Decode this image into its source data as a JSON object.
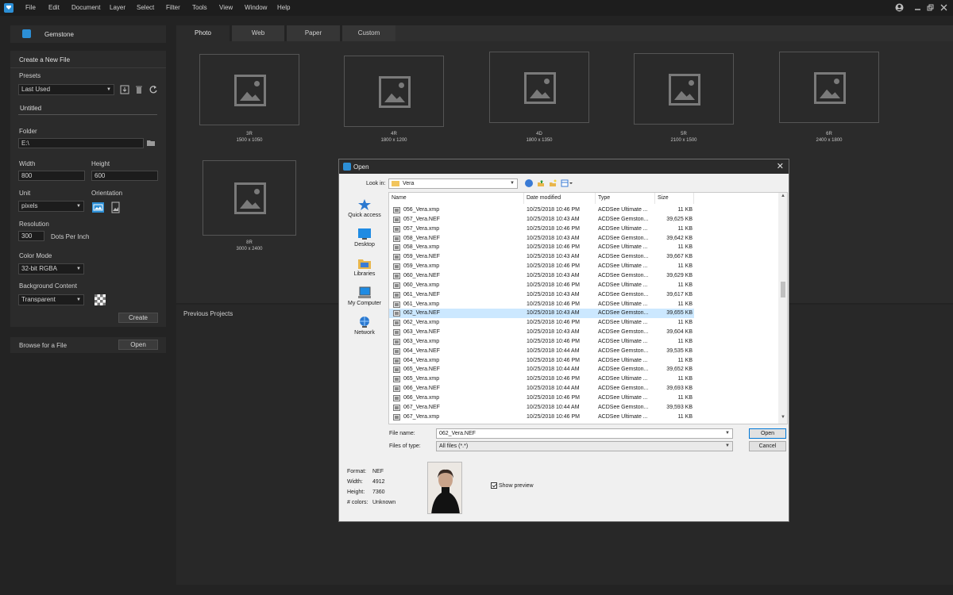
{
  "menu": [
    "File",
    "Edit",
    "Document",
    "Layer",
    "Select",
    "Filter",
    "Tools",
    "View",
    "Window",
    "Help"
  ],
  "app": {
    "name": "Gemstone"
  },
  "create": {
    "heading": "Create a New File",
    "presets_label": "Presets",
    "preset_value": "Last Used",
    "name_value": "Untitled",
    "folder_label": "Folder",
    "folder_value": "E:\\",
    "width_label": "Width",
    "width_value": "800",
    "height_label": "Height",
    "height_value": "600",
    "unit_label": "Unit",
    "unit_value": "pixels",
    "orientation_label": "Orientation",
    "resolution_label": "Resolution",
    "resolution_value": "300",
    "resolution_unit": "Dots Per Inch",
    "color_mode_label": "Color Mode",
    "color_mode_value": "32-bit RGBA",
    "bg_label": "Background Content",
    "bg_value": "Transparent",
    "create_button": "Create"
  },
  "browse": {
    "label": "Browse for a File",
    "open_button": "Open"
  },
  "tabs": [
    "Photo",
    "Web",
    "Paper",
    "Custom"
  ],
  "presets": [
    {
      "name": "3R",
      "size": "1500 x 1050"
    },
    {
      "name": "4R",
      "size": "1800 x 1200"
    },
    {
      "name": "4D",
      "size": "1800 x 1350"
    },
    {
      "name": "5R",
      "size": "2100 x 1500"
    },
    {
      "name": "6R",
      "size": "2400 x 1800"
    },
    {
      "name": "8R",
      "size": "3000 x 2400"
    }
  ],
  "previous_projects_label": "Previous Projects",
  "dialog": {
    "title": "Open",
    "look_in_label": "Look in:",
    "look_in_value": "Vera",
    "places": [
      "Quick access",
      "Desktop",
      "Libraries",
      "My Computer",
      "Network"
    ],
    "columns": [
      "Name",
      "Date modified",
      "Type",
      "Size"
    ],
    "files": [
      [
        "056_Vera.xmp",
        "10/25/2018 10:46 PM",
        "ACDSee Ultimate ...",
        "11 KB"
      ],
      [
        "057_Vera.NEF",
        "10/25/2018 10:43 AM",
        "ACDSee Gemston...",
        "39,625 KB"
      ],
      [
        "057_Vera.xmp",
        "10/25/2018 10:46 PM",
        "ACDSee Ultimate ...",
        "11 KB"
      ],
      [
        "058_Vera.NEF",
        "10/25/2018 10:43 AM",
        "ACDSee Gemston...",
        "39,642 KB"
      ],
      [
        "058_Vera.xmp",
        "10/25/2018 10:46 PM",
        "ACDSee Ultimate ...",
        "11 KB"
      ],
      [
        "059_Vera.NEF",
        "10/25/2018 10:43 AM",
        "ACDSee Gemston...",
        "39,667 KB"
      ],
      [
        "059_Vera.xmp",
        "10/25/2018 10:46 PM",
        "ACDSee Ultimate ...",
        "11 KB"
      ],
      [
        "060_Vera.NEF",
        "10/25/2018 10:43 AM",
        "ACDSee Gemston...",
        "39,629 KB"
      ],
      [
        "060_Vera.xmp",
        "10/25/2018 10:46 PM",
        "ACDSee Ultimate ...",
        "11 KB"
      ],
      [
        "061_Vera.NEF",
        "10/25/2018 10:43 AM",
        "ACDSee Gemston...",
        "39,617 KB"
      ],
      [
        "061_Vera.xmp",
        "10/25/2018 10:46 PM",
        "ACDSee Ultimate ...",
        "11 KB"
      ],
      [
        "062_Vera.NEF",
        "10/25/2018 10:43 AM",
        "ACDSee Gemston...",
        "39,655 KB"
      ],
      [
        "062_Vera.xmp",
        "10/25/2018 10:46 PM",
        "ACDSee Ultimate ...",
        "11 KB"
      ],
      [
        "063_Vera.NEF",
        "10/25/2018 10:43 AM",
        "ACDSee Gemston...",
        "39,604 KB"
      ],
      [
        "063_Vera.xmp",
        "10/25/2018 10:46 PM",
        "ACDSee Ultimate ...",
        "11 KB"
      ],
      [
        "064_Vera.NEF",
        "10/25/2018 10:44 AM",
        "ACDSee Gemston...",
        "39,535 KB"
      ],
      [
        "064_Vera.xmp",
        "10/25/2018 10:46 PM",
        "ACDSee Ultimate ...",
        "11 KB"
      ],
      [
        "065_Vera.NEF",
        "10/25/2018 10:44 AM",
        "ACDSee Gemston...",
        "39,652 KB"
      ],
      [
        "065_Vera.xmp",
        "10/25/2018 10:46 PM",
        "ACDSee Ultimate ...",
        "11 KB"
      ],
      [
        "066_Vera.NEF",
        "10/25/2018 10:44 AM",
        "ACDSee Gemston...",
        "39,693 KB"
      ],
      [
        "066_Vera.xmp",
        "10/25/2018 10:46 PM",
        "ACDSee Ultimate ...",
        "11 KB"
      ],
      [
        "067_Vera.NEF",
        "10/25/2018 10:44 AM",
        "ACDSee Gemston...",
        "39,593 KB"
      ],
      [
        "067_Vera.xmp",
        "10/25/2018 10:46 PM",
        "ACDSee Ultimate ...",
        "11 KB"
      ]
    ],
    "selected_file": "062_Vera.NEF",
    "file_name_label": "File name:",
    "file_name_value": "062_Vera.NEF",
    "file_type_label": "Files of type:",
    "file_type_value": "All files (*.*)",
    "open_button": "Open",
    "cancel_button": "Cancel",
    "info": [
      {
        "label": "Format:",
        "value": "NEF"
      },
      {
        "label": "Width:",
        "value": "4912"
      },
      {
        "label": "Height:",
        "value": "7360"
      },
      {
        "label": "# colors:",
        "value": "Unknown"
      }
    ],
    "show_preview_label": "Show preview",
    "show_preview_checked": true
  },
  "colors": {
    "accent": "#2c8fd6",
    "selection": "#cce8ff",
    "background": "#232323",
    "panel": "#2b2b2b"
  }
}
